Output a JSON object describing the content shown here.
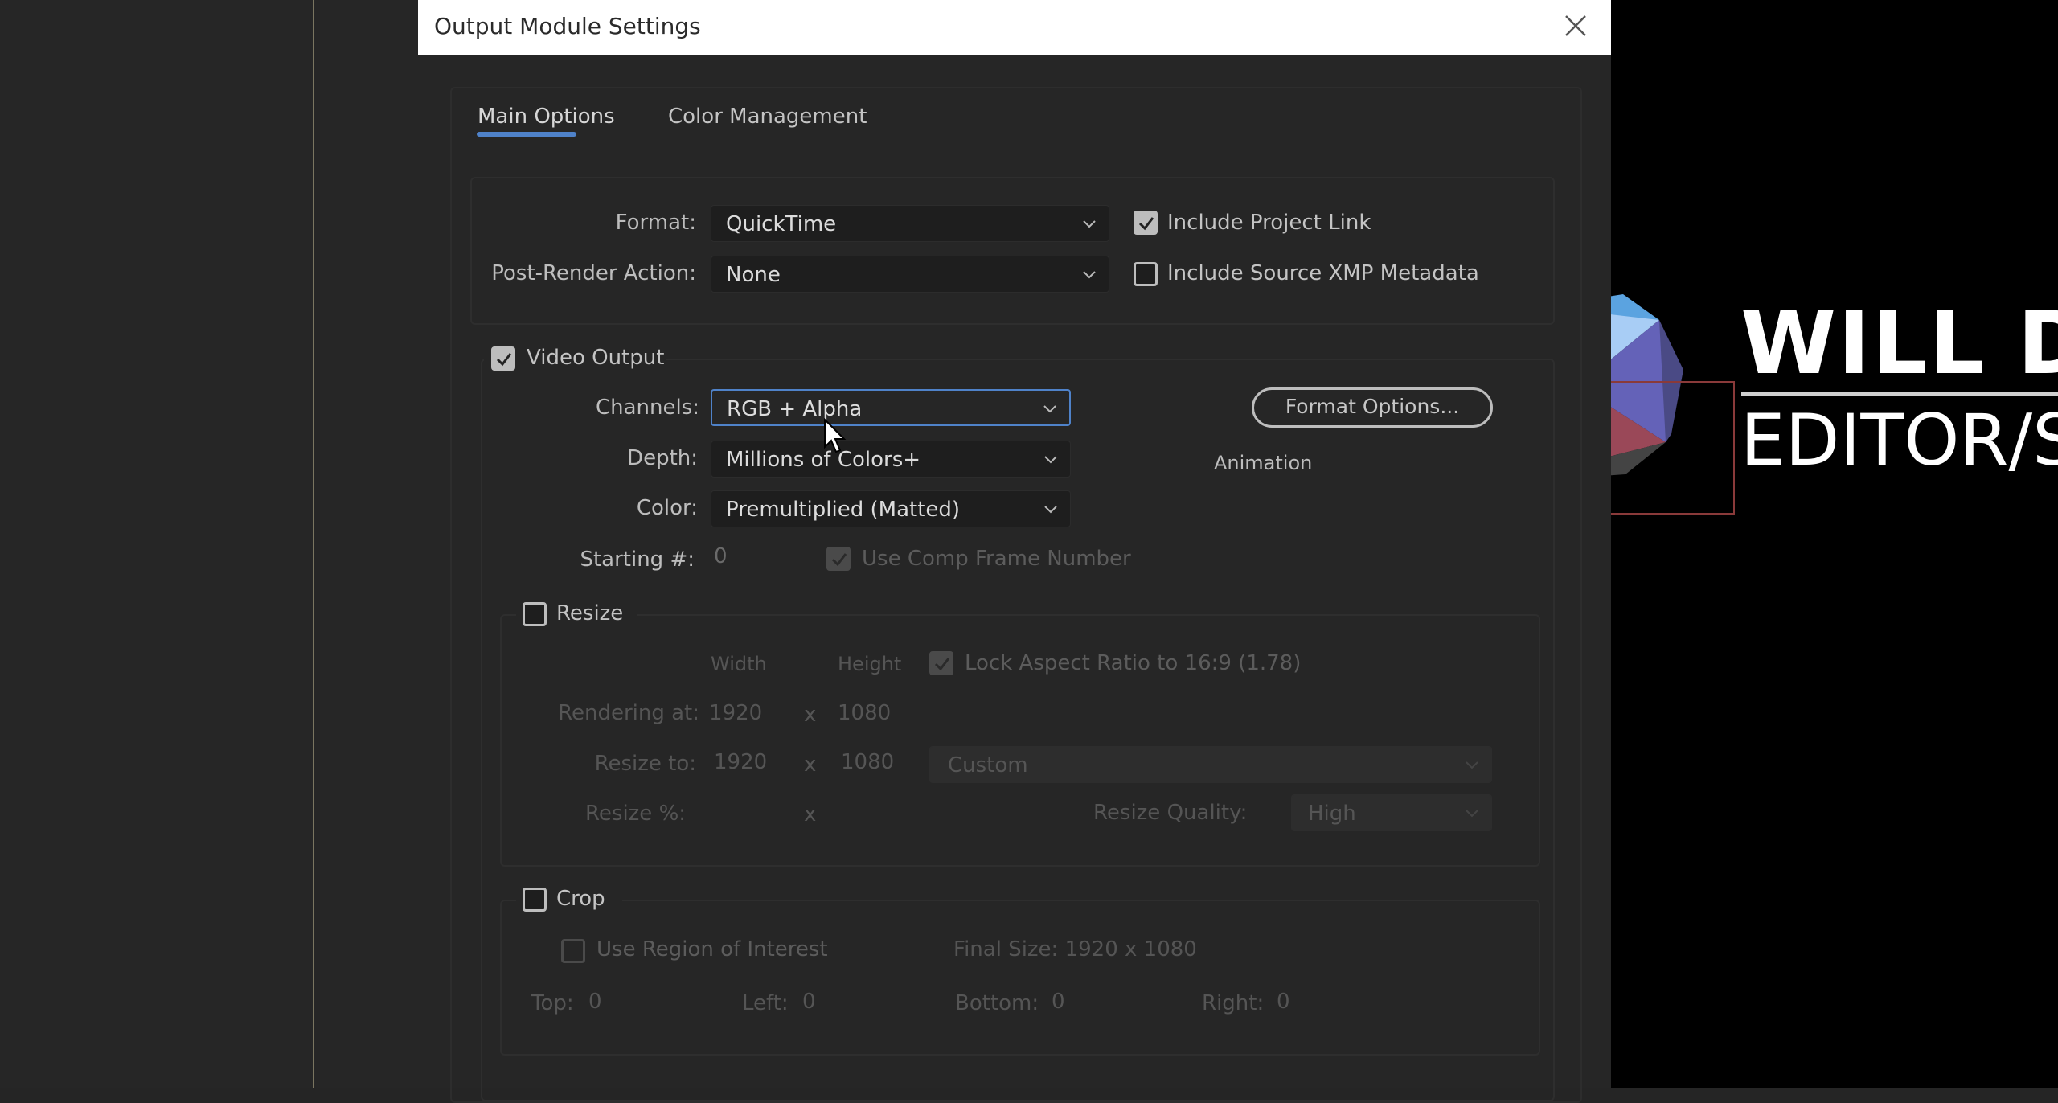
{
  "dialog": {
    "title": "Output Module Settings",
    "close_icon": "close-icon"
  },
  "tabs": [
    {
      "label": "Main Options",
      "active": true
    },
    {
      "label": "Color Management",
      "active": false
    }
  ],
  "general": {
    "format_label": "Format:",
    "format_value": "QuickTime",
    "post_render_label": "Post-Render Action:",
    "post_render_value": "None",
    "include_project_link": {
      "label": "Include Project Link",
      "checked": true
    },
    "include_xmp": {
      "label": "Include Source XMP Metadata",
      "checked": false
    }
  },
  "video_output": {
    "label": "Video Output",
    "checked": true,
    "channels_label": "Channels:",
    "channels_value": "RGB + Alpha",
    "depth_label": "Depth:",
    "depth_value": "Millions of Colors+",
    "color_label": "Color:",
    "color_value": "Premultiplied (Matted)",
    "starting_label": "Starting #:",
    "starting_value": "0",
    "use_comp_frame": {
      "label": "Use Comp Frame Number",
      "checked": true,
      "disabled": true
    },
    "format_options_button": "Format Options...",
    "codec_label": "Animation"
  },
  "resize": {
    "label": "Resize",
    "checked": false,
    "width_header": "Width",
    "height_header": "Height",
    "lock_aspect": {
      "label": "Lock Aspect Ratio to 16:9 (1.78)",
      "checked": true
    },
    "rendering_at_label": "Rendering at:",
    "rendering_width": "1920",
    "rendering_height": "1080",
    "resize_to_label": "Resize to:",
    "resize_width": "1920",
    "resize_height": "1080",
    "preset_value": "Custom",
    "resize_pct_label": "Resize %:",
    "x_sep": "x",
    "quality_label": "Resize Quality:",
    "quality_value": "High"
  },
  "crop": {
    "label": "Crop",
    "checked": false,
    "use_roi": {
      "label": "Use Region of Interest",
      "checked": false
    },
    "final_size": "Final Size: 1920 x 1080",
    "top_label": "Top:",
    "top_value": "0",
    "left_label": "Left:",
    "left_value": "0",
    "bottom_label": "Bottom:",
    "bottom_value": "0",
    "right_label": "Right:",
    "right_value": "0"
  },
  "preview": {
    "name_text": "WILL DA",
    "role_text": "EDITOR/SI"
  },
  "colors": {
    "accent": "#4f82c9",
    "dialog_bg": "#262626",
    "titlebar_bg": "#ffffff"
  }
}
